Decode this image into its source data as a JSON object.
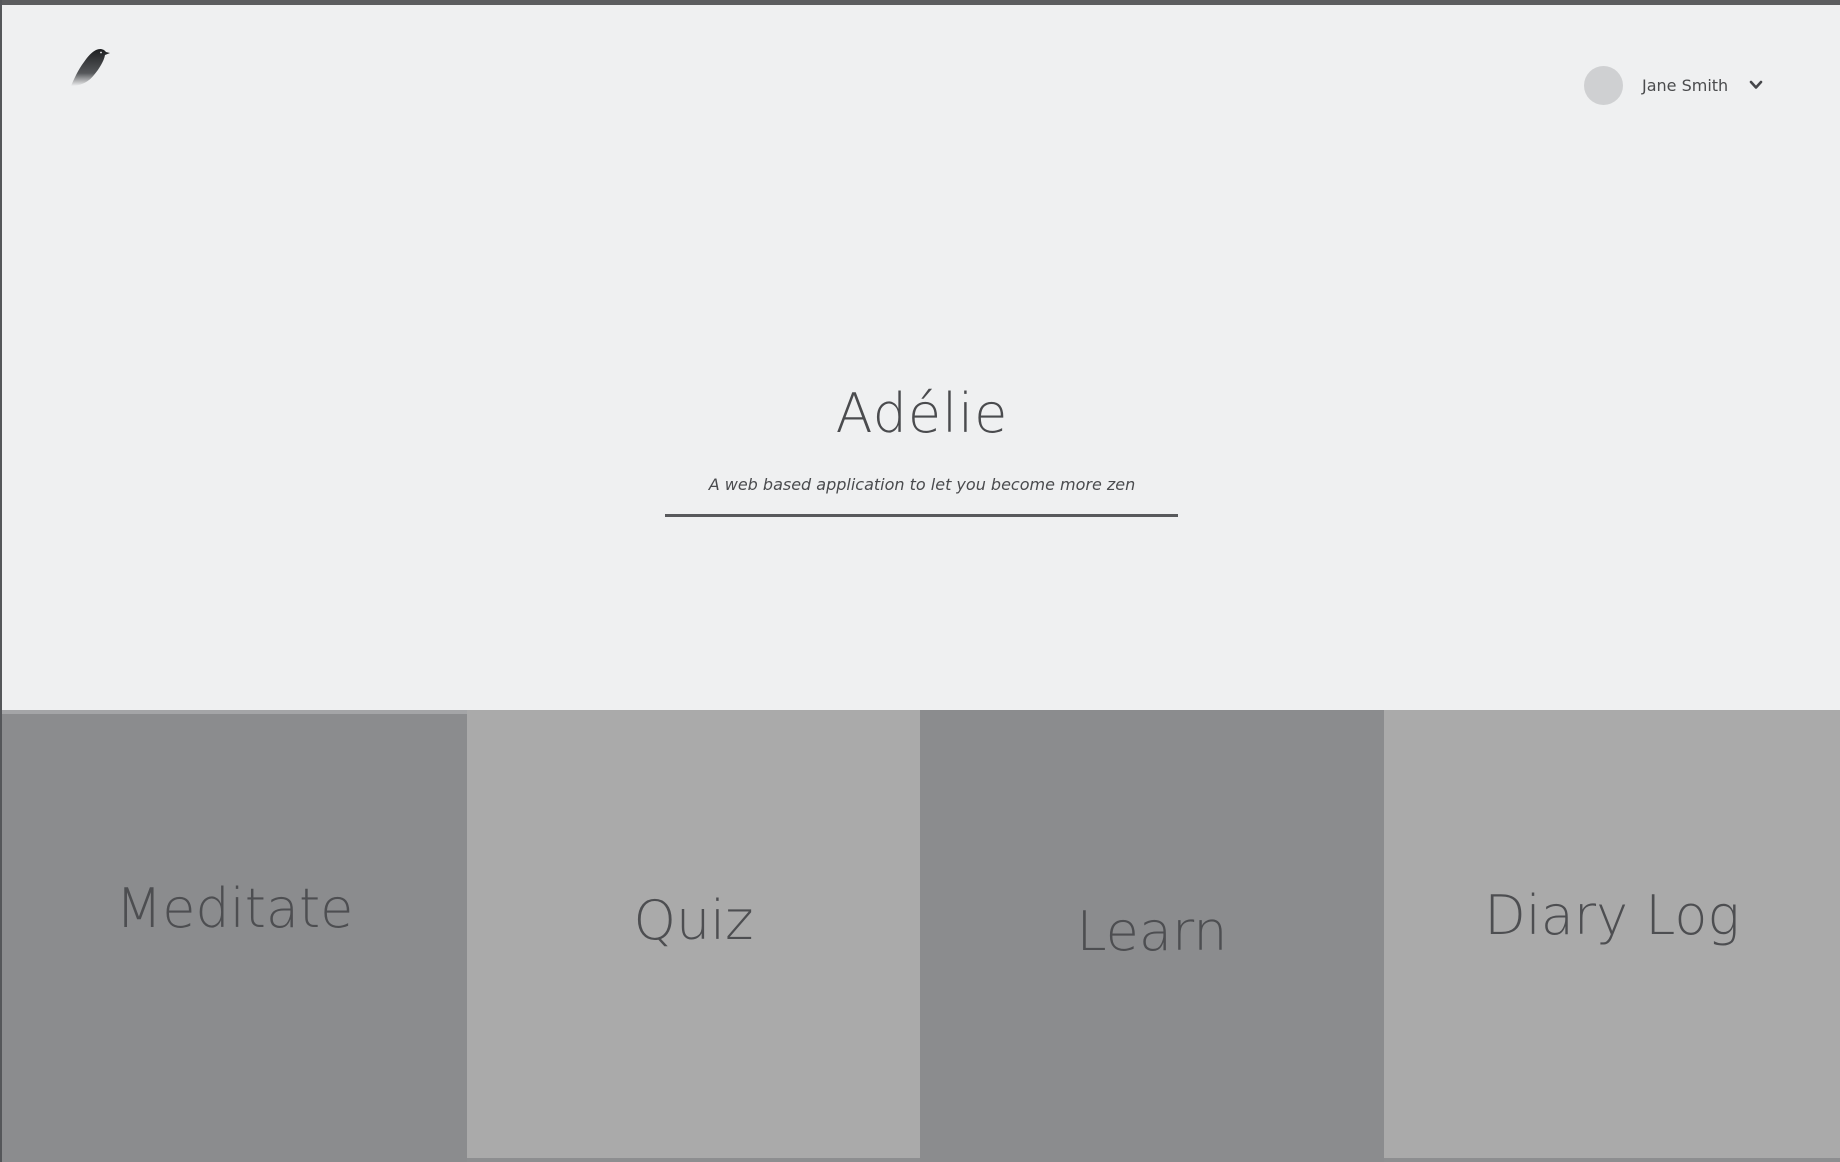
{
  "header": {
    "logo_icon": "bird-logo-icon",
    "user": {
      "name": "Jane Smith",
      "avatar_icon": "avatar-placeholder",
      "menu_icon": "chevron-down-icon"
    }
  },
  "hero": {
    "title": "Adélie",
    "subtitle": "A web based application to let you become more zen"
  },
  "tiles": [
    {
      "label": "Meditate"
    },
    {
      "label": "Quiz"
    },
    {
      "label": "Learn"
    },
    {
      "label": "Diary Log"
    }
  ],
  "colors": {
    "background": "#eff0f1",
    "tile_dark": "#8b8c8e",
    "tile_light": "#aaaaaa",
    "text": "#4a4b4e"
  }
}
